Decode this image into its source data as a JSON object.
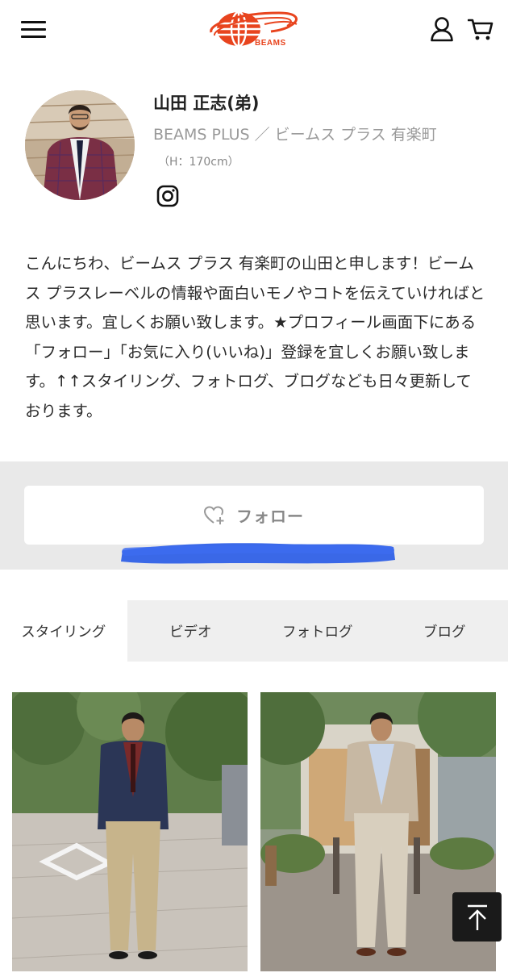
{
  "header": {
    "logo_text": "BEAMS",
    "menu_icon": "hamburger-menu-icon",
    "user_icon": "user-icon",
    "cart_icon": "cart-icon"
  },
  "profile": {
    "name": "山田 正志(弟)",
    "shop": "BEAMS PLUS ／ ビームス プラス 有楽町",
    "height": "（H：170cm）",
    "social_icon": "instagram-icon"
  },
  "bio": "こんにちわ、ビームス プラス 有楽町の山田と申します！ビームス プラスレーベルの情報や面白いモノやコトを伝えていければと思います。宜しくお願い致します。★プロフィール画面下にある「フォロー」「お気に入り(いいね)」登録を宜しくお願い致します。↑↑スタイリング、フォトログ、ブログなども日々更新しております。",
  "follow": {
    "label": "フォロー",
    "icon": "heart-plus-icon"
  },
  "tabs": [
    {
      "label": "スタイリング",
      "active": true
    },
    {
      "label": "ビデオ",
      "active": false
    },
    {
      "label": "フォトログ",
      "active": false
    },
    {
      "label": "ブログ",
      "active": false
    }
  ],
  "scroll_top_icon": "arrow-up-to-top-icon",
  "colors": {
    "brand": "#e8441e",
    "tab_bg": "#efefef",
    "follow_band": "#e9e9e9",
    "scribble": "#2a5ce6"
  }
}
